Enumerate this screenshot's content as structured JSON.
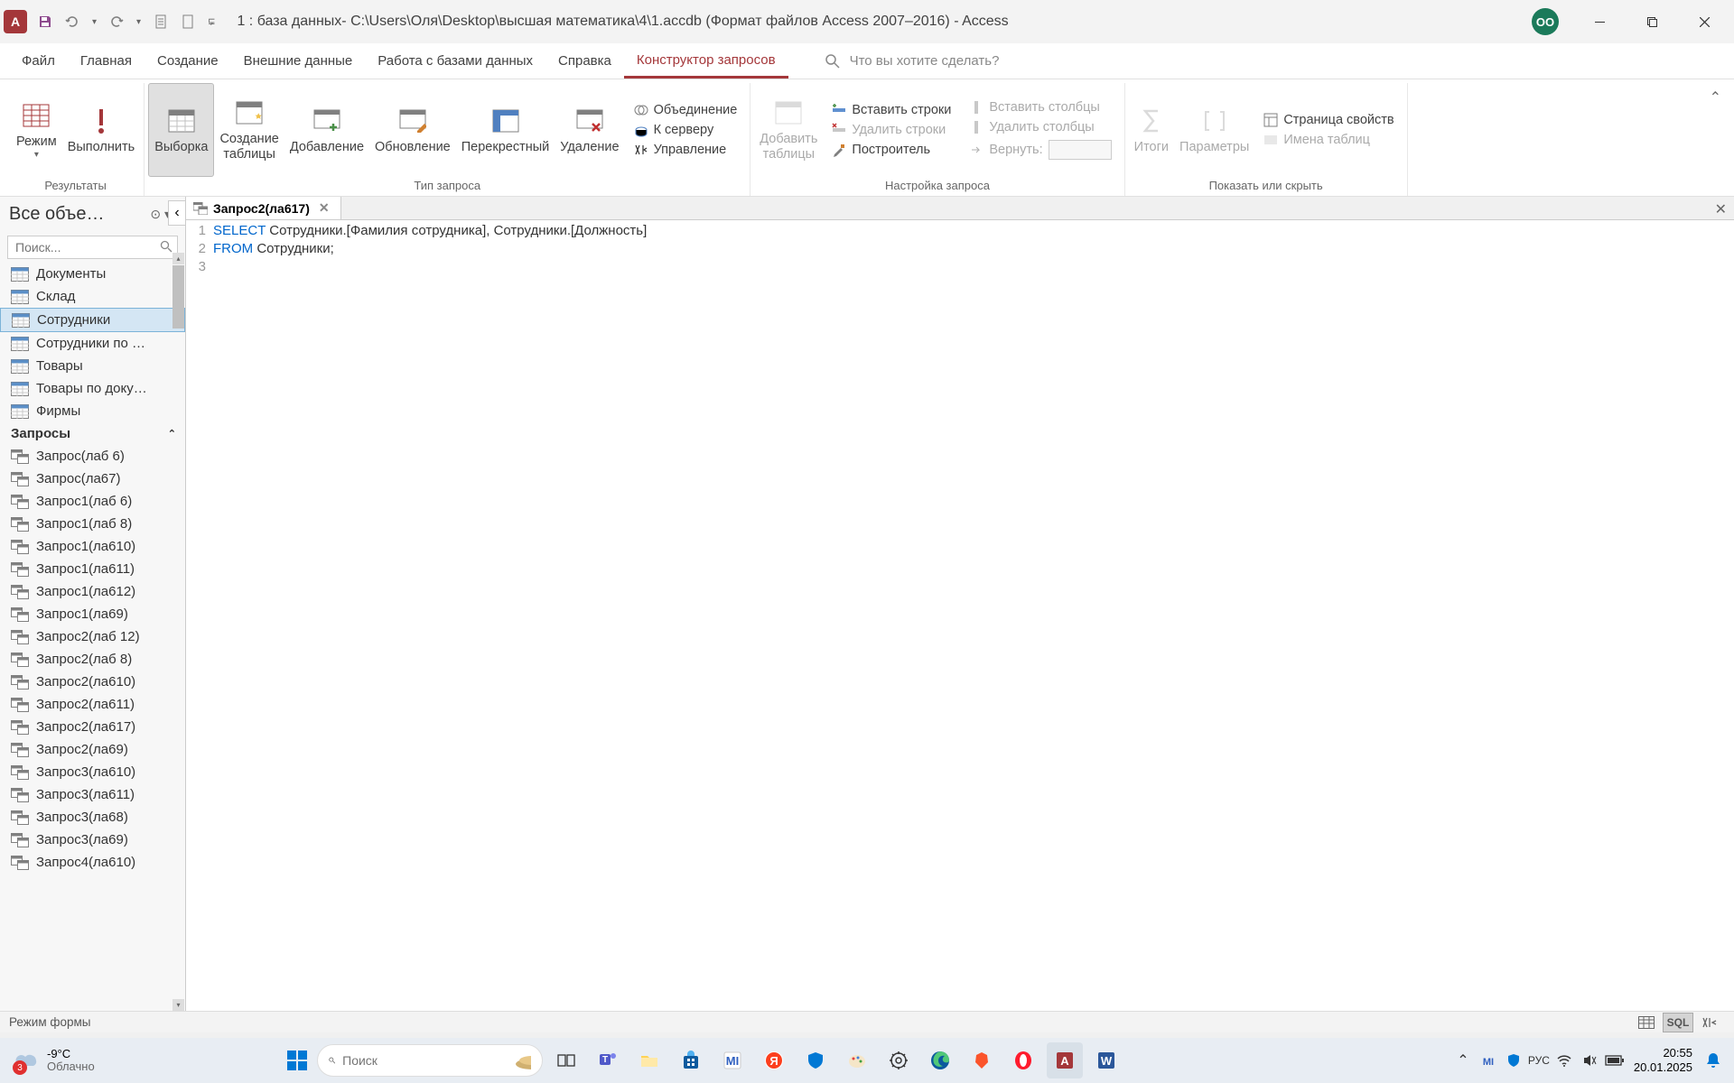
{
  "title_bar": {
    "title": "1 : база данных- C:\\Users\\Оля\\Desktop\\высшая математика\\4\\1.accdb (Формат файлов Access 2007–2016)  -  Access",
    "user_initials": "ОО"
  },
  "ribbon_tabs": {
    "file": "Файл",
    "home": "Главная",
    "create": "Создание",
    "external": "Внешние данные",
    "dbtools": "Работа с базами данных",
    "help": "Справка",
    "query_design": "Конструктор запросов"
  },
  "search_placeholder": "Что вы хотите сделать?",
  "ribbon": {
    "results": {
      "label": "Результаты",
      "view": "Режим",
      "run": "Выполнить"
    },
    "query_type": {
      "label": "Тип запроса",
      "select": "Выборка",
      "make_table": "Создание\nтаблицы",
      "append": "Добавление",
      "update": "Обновление",
      "crosstab": "Перекрестный",
      "delete": "Удаление",
      "union": "Объединение",
      "passthrough": "К серверу",
      "data_def": "Управление"
    },
    "query_setup": {
      "label": "Настройка запроса",
      "add_tables": "Добавить\nтаблицы",
      "insert_rows": "Вставить строки",
      "delete_rows": "Удалить строки",
      "builder": "Построитель",
      "insert_cols": "Вставить столбцы",
      "delete_cols": "Удалить столбцы",
      "return": "Вернуть:"
    },
    "show_hide": {
      "label": "Показать или скрыть",
      "totals": "Итоги",
      "parameters": "Параметры",
      "prop_sheet": "Страница свойств",
      "table_names": "Имена таблиц"
    }
  },
  "nav": {
    "title": "Все объе…",
    "search_placeholder": "Поиск...",
    "tables": [
      "Документы",
      "Склад",
      "Сотрудники",
      "Сотрудники по …",
      "Товары",
      "Товары по доку…",
      "Фирмы"
    ],
    "selected_table": "Сотрудники",
    "queries_header": "Запросы",
    "queries": [
      "Запрос(лаб 6)",
      "Запрос(ла67)",
      "Запрос1(лаб 6)",
      "Запрос1(лаб 8)",
      "Запрос1(ла610)",
      "Запрос1(ла611)",
      "Запрос1(ла612)",
      "Запрос1(ла69)",
      "Запрос2(лаб 12)",
      "Запрос2(лаб 8)",
      "Запрос2(ла610)",
      "Запрос2(ла611)",
      "Запрос2(ла617)",
      "Запрос2(ла69)",
      "Запрос3(ла610)",
      "Запрос3(ла611)",
      "Запрос3(ла68)",
      "Запрос3(ла69)",
      "Запрос4(ла610)"
    ]
  },
  "doc_tab": "Запрос2(ла617)",
  "sql": {
    "line1_kw": "SELECT",
    "line1_rest": " Сотрудники.[Фамилия сотрудника], Сотрудники.[Должность]",
    "line2_kw": "FROM",
    "line2_rest": " Сотрудники;"
  },
  "status": {
    "mode": "Режим формы",
    "sql": "SQL"
  },
  "taskbar": {
    "temp": "-9°С",
    "condition": "Облачно",
    "badge": "3",
    "search": "Поиск",
    "lang": "РУС",
    "time": "20:55",
    "date": "20.01.2025"
  }
}
